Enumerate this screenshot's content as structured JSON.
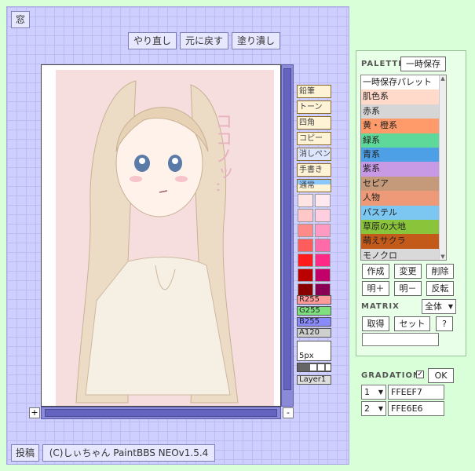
{
  "top": {
    "window_button": "窓",
    "redo": "やり直し",
    "undo": "元に戻す",
    "fill": "塗り潰し"
  },
  "canvas": {
    "text": "ココノッ‥"
  },
  "scroll": {
    "plus": "+",
    "minus": "-"
  },
  "tools": [
    "鉛筆",
    "トーン",
    "四角",
    "コピー",
    "消しペン",
    "手書き",
    "通常"
  ],
  "swatches": [
    [
      "#ffe4e4",
      "#ffe8ee"
    ],
    [
      "#ffc7c7",
      "#ffcfe0"
    ],
    [
      "#ff8a8a",
      "#ff9ac2"
    ],
    [
      "#ff5c5c",
      "#ff6aa8"
    ],
    [
      "#ff1c1c",
      "#ff2a88"
    ],
    [
      "#bb0000",
      "#c2006a"
    ],
    [
      "#880000",
      "#8a0055"
    ]
  ],
  "sliders": {
    "r": "R255",
    "g": "G255",
    "b": "B255",
    "a": "A120"
  },
  "brush_size": "5px",
  "layer": "Layer1",
  "bottom": {
    "post": "投稿",
    "credit": "(C)しぃちゃん PaintBBS NEOv1.5.4"
  },
  "palette": {
    "title": "PALETTE",
    "save_button": "一時保存",
    "items": [
      {
        "label": "一時保存パレット",
        "color": "#ffffff"
      },
      {
        "label": "肌色系",
        "color": "#ffd9c9"
      },
      {
        "label": "赤系",
        "color": "#d6d6d6"
      },
      {
        "label": "黄・橙系",
        "color": "#ff9a6a"
      },
      {
        "label": "緑系",
        "color": "#5fd99a"
      },
      {
        "label": "青系",
        "color": "#4d9fe6"
      },
      {
        "label": "紫系",
        "color": "#c89ae6"
      },
      {
        "label": "セピア",
        "color": "#c49a7a"
      },
      {
        "label": "人物",
        "color": "#ee9a78"
      },
      {
        "label": "パステル",
        "color": "#7cc7f2"
      },
      {
        "label": "草原の大地",
        "color": "#8ac43a"
      },
      {
        "label": "萌えサクラ",
        "color": "#c45a1a"
      },
      {
        "label": "モノクロ",
        "color": "#d9d9d9"
      }
    ],
    "buttons": {
      "create": "作成",
      "change": "変更",
      "delete": "削除",
      "light_plus": "明＋",
      "light_minus": "明－",
      "invert": "反転"
    }
  },
  "matrix": {
    "title": "MATRIX",
    "select": "全体",
    "get": "取得",
    "set": "セット",
    "help": "?"
  },
  "gradation": {
    "title": "GRADATION",
    "ok": "OK",
    "row1_index": "1",
    "row1_value": "FFEEF7",
    "row2_index": "2",
    "row2_value": "FFE6E6"
  }
}
